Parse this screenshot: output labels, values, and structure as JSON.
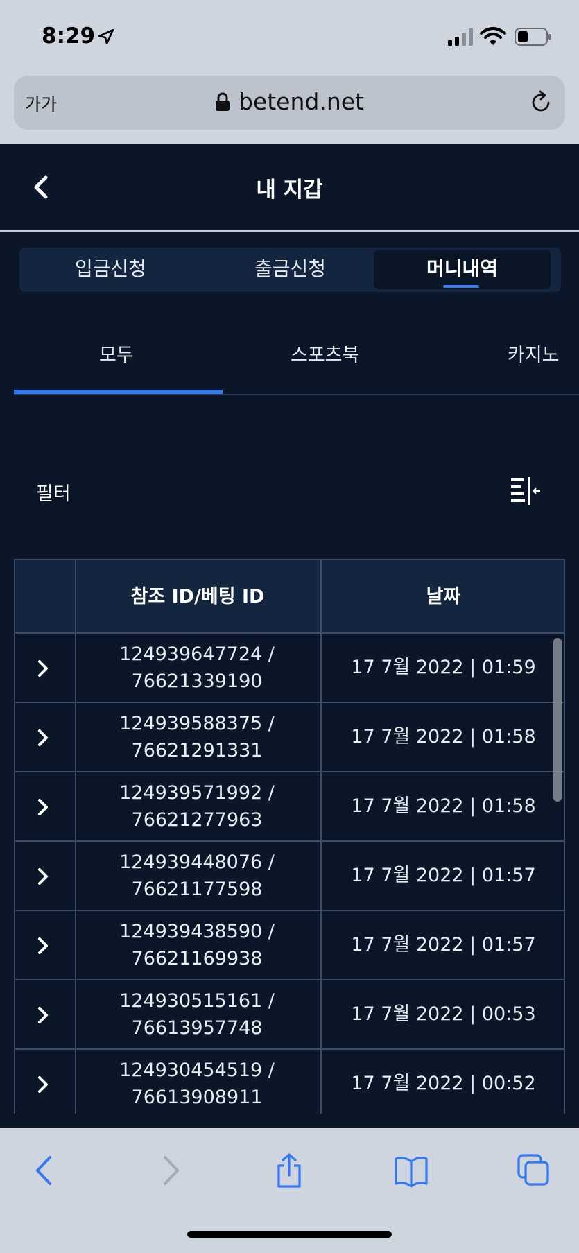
{
  "status": {
    "time": "8:29"
  },
  "browser": {
    "text_size": "가가",
    "url": "betend.net"
  },
  "header": {
    "title": "내 지갑"
  },
  "tabs": [
    {
      "label": "입금신청"
    },
    {
      "label": "출금신청"
    },
    {
      "label": "머니내역"
    }
  ],
  "subtabs": [
    {
      "label": "모두"
    },
    {
      "label": "스포츠북"
    },
    {
      "label": "카지노"
    }
  ],
  "filter": {
    "label": "필터"
  },
  "table": {
    "headers": [
      "",
      "참조 ID/베팅 ID",
      "날짜"
    ],
    "rows": [
      {
        "ref_line1": "124939647724 /",
        "ref_line2": "76621339190",
        "date": "17 7월 2022 | 01:59"
      },
      {
        "ref_line1": "124939588375 /",
        "ref_line2": "76621291331",
        "date": "17 7월 2022 | 01:58"
      },
      {
        "ref_line1": "124939571992 /",
        "ref_line2": "76621277963",
        "date": "17 7월 2022 | 01:58"
      },
      {
        "ref_line1": "124939448076 /",
        "ref_line2": "76621177598",
        "date": "17 7월 2022 | 01:57"
      },
      {
        "ref_line1": "124939438590 /",
        "ref_line2": "76621169938",
        "date": "17 7월 2022 | 01:57"
      },
      {
        "ref_line1": "124930515161 /",
        "ref_line2": "76613957748",
        "date": "17 7월 2022 | 00:53"
      },
      {
        "ref_line1": "124930454519 /",
        "ref_line2": "76613908911",
        "date": "17 7월 2022 | 00:52"
      }
    ]
  },
  "colors": {
    "background": "#0b1628",
    "accent": "#2f7df0",
    "panel": "#13253f",
    "ios_blue": "#3478f6"
  },
  "icons": {
    "back": "chevron-left-icon",
    "row": "chevron-right-icon",
    "filter": "filter-collapse-icon",
    "reload": "reload-icon",
    "lock": "lock-icon"
  }
}
